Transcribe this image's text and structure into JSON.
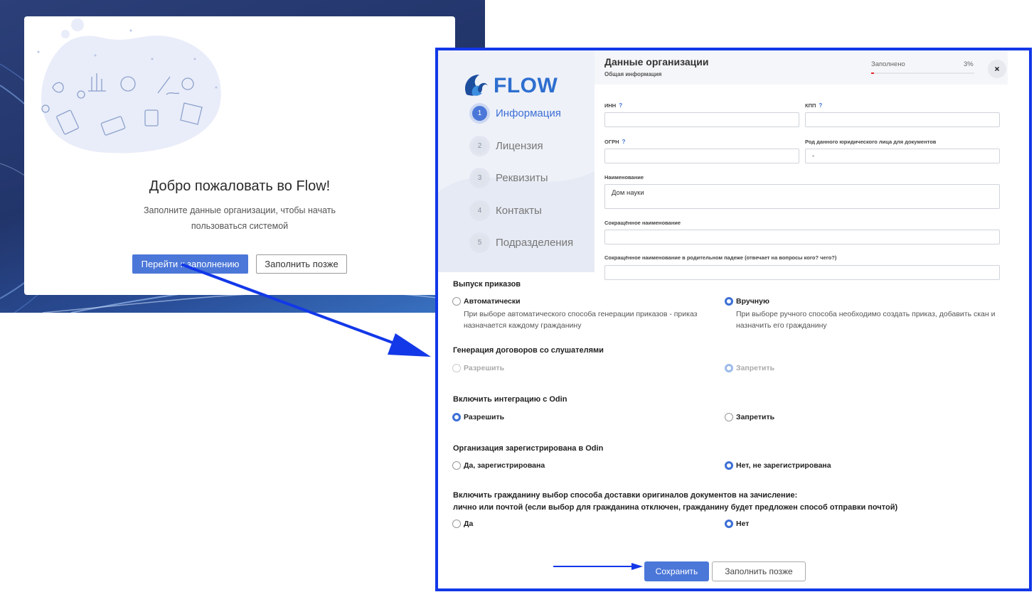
{
  "welcome": {
    "title": "Добро пожаловать во Flow!",
    "subtitle": "Заполните данные организации, чтобы начать пользоваться системой",
    "primary_button": "Перейти к заполнению",
    "secondary_button": "Заполнить позже"
  },
  "modal": {
    "logo_text": "FLOW",
    "steps": [
      {
        "num": "1",
        "label": "Информация",
        "active": true
      },
      {
        "num": "2",
        "label": "Лицензия",
        "active": false
      },
      {
        "num": "3",
        "label": "Реквизиты",
        "active": false
      },
      {
        "num": "4",
        "label": "Контакты",
        "active": false
      },
      {
        "num": "5",
        "label": "Подразделения",
        "active": false
      }
    ],
    "header": {
      "title": "Данные организации",
      "subtitle": "Общая информация",
      "filled_label": "Заполнено",
      "filled_percent": "3%",
      "progress": 0.03,
      "close": "×"
    },
    "fields": {
      "inn": {
        "label": "ИНН",
        "hint": "?",
        "value": ""
      },
      "kpp": {
        "label": "КПП",
        "hint": "?",
        "value": ""
      },
      "ogrn": {
        "label": "ОГРН",
        "hint": "?",
        "value": ""
      },
      "gender": {
        "label": "Род данного юридического лица для документов",
        "value": "-"
      },
      "name": {
        "label": "Наименование",
        "value": "Дом науки"
      },
      "short_name": {
        "label": "Сокращённое наименование",
        "value": ""
      },
      "short_name_gen": {
        "label": "Сокращённое наименование в родительном падеже (отвечает на вопросы кого? чего?)",
        "value": ""
      }
    },
    "orders": {
      "title": "Выпуск приказов",
      "auto_label": "Автоматически",
      "auto_desc": "При выборе автоматического способа генерации приказов - приказ назначается каждому гражданину",
      "manual_label": "Вручную",
      "manual_desc": "При выборе ручного способа необходимо создать приказ, добавить скан и назначить его гражданину",
      "selected": "manual"
    },
    "contracts": {
      "title": "Генерация договоров со слушателями",
      "allow_label": "Разрешить",
      "deny_label": "Запретить",
      "selected": "deny"
    },
    "odin_integration": {
      "title": "Включить интеграцию с Odin",
      "allow_label": "Разрешить",
      "deny_label": "Запретить",
      "selected": "allow"
    },
    "odin_registered": {
      "title": "Организация зарегистрирована в Odin",
      "yes_label": "Да, зарегистрирована",
      "no_label": "Нет, не зарегистрирована",
      "selected": "no"
    },
    "delivery": {
      "title_line1": "Включить гражданину выбор способа доставки оригиналов документов на зачисление:",
      "title_line2": "лично или почтой (если выбор для гражданина отключен, гражданину будет предложен способ отправки почтой)",
      "yes_label": "Да",
      "no_label": "Нет",
      "selected": "no"
    },
    "footer": {
      "save_button": "Сохранить",
      "later_button": "Заполнить позже"
    }
  },
  "colors": {
    "accent": "#4b77d8",
    "highlight_border": "#1238e8",
    "progress": "#e32727"
  }
}
